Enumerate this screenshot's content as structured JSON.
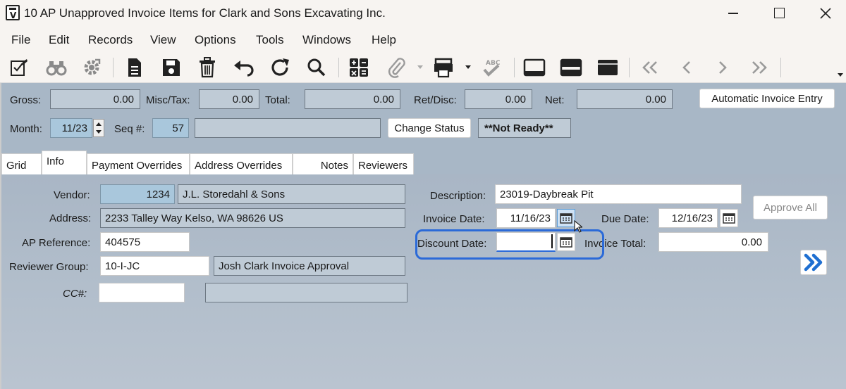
{
  "window": {
    "title": "10 AP Unapproved Invoice Items for Clark and Sons Excavating Inc."
  },
  "menu": [
    "File",
    "Edit",
    "Records",
    "View",
    "Options",
    "Tools",
    "Windows",
    "Help"
  ],
  "toolbar": {
    "icons": [
      "edit-check-icon",
      "binoculars-icon",
      "gear-icon",
      "document-icon",
      "save-icon",
      "trash-icon",
      "undo-icon",
      "refresh-icon",
      "search-icon",
      "calculator-icon",
      "attachment-icon",
      "print-icon",
      "spellcheck-icon",
      "layout-bottom-icon",
      "layout-split-icon",
      "layout-top-icon",
      "first-record-icon",
      "previous-record-icon",
      "next-record-icon",
      "last-record-icon"
    ]
  },
  "header": {
    "gross_label": "Gross:",
    "gross_value": "0.00",
    "misc_label": "Misc/Tax:",
    "misc_value": "0.00",
    "total_label": "Total:",
    "total_value": "0.00",
    "retdisc_label": "Ret/Disc:",
    "retdisc_value": "0.00",
    "net_label": "Net:",
    "net_value": "0.00",
    "auto_invoice_button": "Automatic Invoice Entry",
    "month_label": "Month:",
    "month_value": "11/23",
    "seq_label": "Seq #:",
    "seq_value": "57",
    "seq_desc": "",
    "change_status_button": "Change Status",
    "status_text": "**Not Ready**"
  },
  "tabs": [
    {
      "label": "Grid",
      "active": false
    },
    {
      "label": "Info",
      "active": true
    },
    {
      "label": "Payment Overrides",
      "active": false
    },
    {
      "label": "Address Overrides",
      "active": false
    },
    {
      "label": "Notes",
      "active": false
    },
    {
      "label": "Reviewers",
      "active": false
    }
  ],
  "info": {
    "vendor_label": "Vendor:",
    "vendor_number": "1234",
    "vendor_name": "J.L. Storedahl & Sons",
    "address_label": "Address:",
    "address_value": "2233 Talley Way  Kelso, WA  98626  US",
    "apref_label": "AP Reference:",
    "apref_value": "404575",
    "revgroup_label": "Reviewer Group:",
    "revgroup_value": "10-I-JC",
    "revgroup_desc": "Josh Clark Invoice Approval",
    "cc_label": "CC#:",
    "cc_value": "",
    "cc_desc": "",
    "description_label": "Description:",
    "description_value": "23019-Daybreak Pit",
    "invoice_date_label": "Invoice Date:",
    "invoice_date_value": "11/16/23",
    "due_date_label": "Due Date:",
    "due_date_value": "12/16/23",
    "discount_date_label": "Discount Date:",
    "discount_date_value": "",
    "invoice_total_label": "Invoice Total:",
    "invoice_total_value": "0.00",
    "approve_all_button": "Approve All"
  },
  "colors": {
    "panel_bg": "#a8b7c6",
    "readonly_bg": "#bfcbd6",
    "key_field_bg": "#a9c7dc",
    "highlight_border": "#2b6ad8",
    "next_arrow": "#1f6fd1"
  }
}
